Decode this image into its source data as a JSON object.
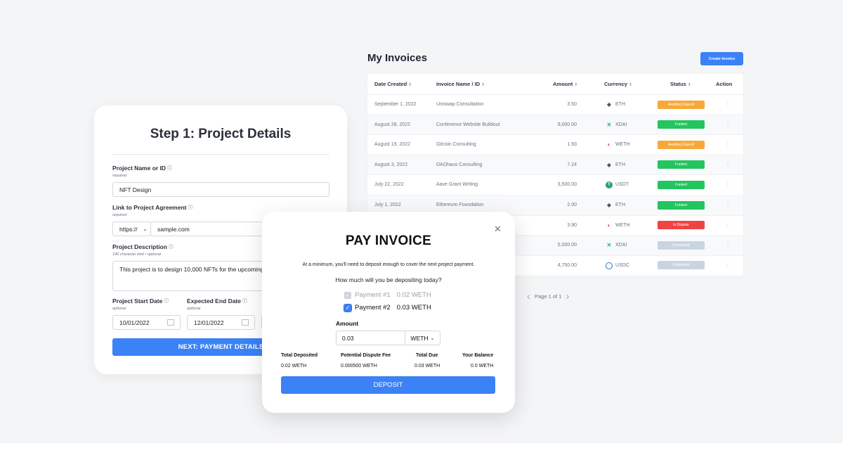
{
  "invoices": {
    "title": "My Invoices",
    "create_button": "Create Invoice",
    "columns": {
      "date": "Date Created",
      "name": "Invoice Name / ID",
      "amount": "Amount",
      "currency": "Currency",
      "status": "Status",
      "action": "Action"
    },
    "sort_glyph": "⬍",
    "rows": [
      {
        "date": "September 1, 2022",
        "name": "Uniswap Consultation",
        "amount": "3.50",
        "currency": "ETH",
        "icon": "eth-icon",
        "status": "Awaiting Deposit",
        "kind": "awaiting"
      },
      {
        "date": "August 28, 2022",
        "name": "Conference Website Buildout",
        "amount": "9,000.00",
        "currency": "XDAI",
        "icon": "xdai-icon",
        "status": "Funded",
        "kind": "funded"
      },
      {
        "date": "August 19, 2022",
        "name": "Gitcoin Consulting",
        "amount": "1.93",
        "currency": "WETH",
        "icon": "weth-icon",
        "status": "Awaiting Deposit",
        "kind": "awaiting"
      },
      {
        "date": "August 3, 2022",
        "name": "DAOhaus Consulting",
        "amount": "7.24",
        "currency": "ETH",
        "icon": "eth-icon",
        "status": "Funded",
        "kind": "funded"
      },
      {
        "date": "July 22, 2022",
        "name": "Aave Grant Writing",
        "amount": "3,500.00",
        "currency": "USDT",
        "icon": "usdt-icon",
        "status": "Funded",
        "kind": "funded"
      },
      {
        "date": "July 1, 2022",
        "name": "Ethereum Foundation",
        "amount": "2.00",
        "currency": "ETH",
        "icon": "eth-icon",
        "status": "Funded",
        "kind": "funded"
      },
      {
        "date": "",
        "name": "",
        "amount": "3.90",
        "currency": "WETH",
        "icon": "weth-icon",
        "status": "In Dispute",
        "kind": "dispute"
      },
      {
        "date": "",
        "name": "",
        "amount": "5,000.00",
        "currency": "XDAI",
        "icon": "xdai-icon",
        "status": "Completed",
        "kind": "completed"
      },
      {
        "date": "",
        "name": "",
        "amount": "4,750.00",
        "currency": "USDC",
        "icon": "usdc-icon",
        "status": "Completed",
        "kind": "completed"
      }
    ],
    "pager": "Page 1 of 1",
    "colors": {
      "accent": "#3b82f6",
      "awaiting": "#f6a93b",
      "funded": "#22c55e",
      "dispute": "#ef4444",
      "completed": "#c9d4e3"
    }
  },
  "step1": {
    "title": "Step 1: Project Details",
    "project_name": {
      "label": "Project Name or ID",
      "hint": "required",
      "value": "NFT Design"
    },
    "agreement": {
      "label": "Link to Project Agreement",
      "hint": "required",
      "protocol": "https://",
      "value": "sample.com"
    },
    "description": {
      "label": "Project Description",
      "hint": "140 character limit • optional",
      "value": "This project is to design 10,000 NFTs for the upcoming"
    },
    "start_date": {
      "label": "Project Start Date",
      "hint": "optional",
      "value": "10/01/2022"
    },
    "end_date": {
      "label": "Expected End Date",
      "hint": "optional",
      "value": "12/01/2022"
    },
    "next_button": "NEXT: PAYMENT DETAILS"
  },
  "pay_modal": {
    "title": "PAY INVOICE",
    "note": "At a minimum, you'll need to deposit enough to cover the next project payment.",
    "question": "How much will you be depositing today?",
    "payments": [
      {
        "label": "Payment #1",
        "amount": "0.02 WETH",
        "checked": true,
        "disabled": true
      },
      {
        "label": "Payment #2",
        "amount": "0.03 WETH",
        "checked": true,
        "disabled": false
      }
    ],
    "amount_label": "Amount",
    "amount_value": "0.03",
    "token": "WETH",
    "summary": {
      "deposited_label": "Total Deposited",
      "deposited_value": "0.02 WETH",
      "fee_label": "Potential Dispute Fee",
      "fee_value": "0.000500 WETH",
      "due_label": "Total Due",
      "due_value": "0.03 WETH",
      "balance_label": "Your Balance",
      "balance_value": "0.0 WETH"
    },
    "deposit_button": "DEPOSIT"
  }
}
